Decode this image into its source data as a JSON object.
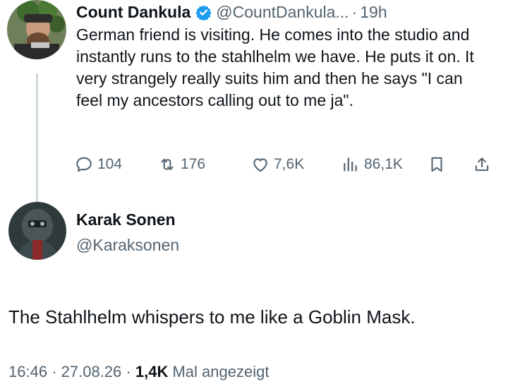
{
  "tweet1": {
    "name": "Count Dankula",
    "handle": "@CountDankula...",
    "separator": "·",
    "time": "19h",
    "text": "German friend is visiting. He comes into the studio and instantly runs to the stahlhelm we have. He puts it on. It very strangely really suits him and then he says \"I can feel my ancestors calling out to me ja\".",
    "actions": {
      "replies": "104",
      "reposts": "176",
      "likes": "7,6K",
      "views": "86,1K"
    }
  },
  "tweet2": {
    "name": "Karak Sonen",
    "handle": "@Karaksonen",
    "text": "The Stahlhelm whispers to me like a Goblin Mask.",
    "meta": {
      "time": "16:46",
      "sep1": "·",
      "date": "27.08.26",
      "sep2": "·",
      "views": "1,4K",
      "views_suffix": "Mal angezeigt"
    }
  },
  "colors": {
    "text": "#0f1419",
    "secondary": "#536471",
    "verified": "#1d9bf0",
    "thread_line": "#cfd9de"
  },
  "icons": [
    "reply-icon",
    "repost-icon",
    "like-icon",
    "views-icon",
    "bookmark-icon",
    "share-icon",
    "verified-badge-icon"
  ]
}
